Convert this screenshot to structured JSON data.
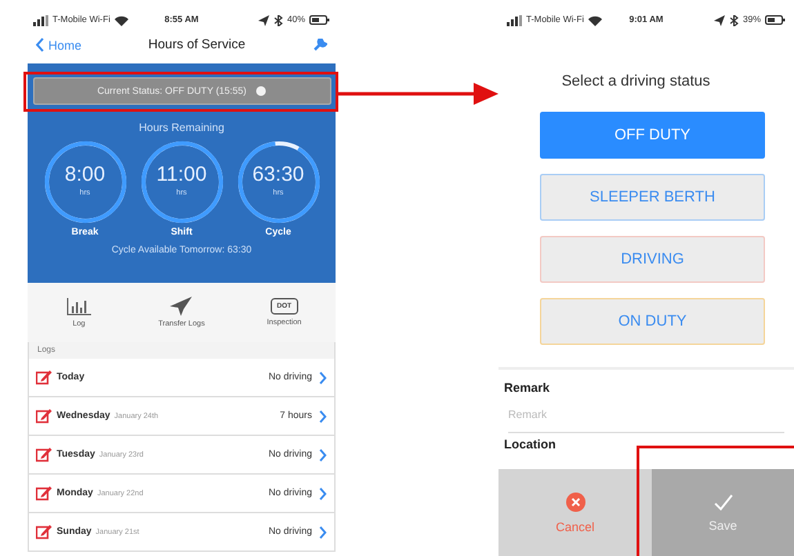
{
  "left_screen": {
    "status_bar": {
      "carrier": "T-Mobile Wi-Fi",
      "time": "8:55 AM",
      "battery": "40%"
    },
    "nav": {
      "back": "Home",
      "title": "Hours of Service"
    },
    "current_status": "Current Status: OFF DUTY (15:55)",
    "hours_title": "Hours Remaining",
    "gauges": [
      {
        "value": "8:00",
        "unit": "hrs",
        "label": "Break",
        "level": 1
      },
      {
        "value": "11:00",
        "unit": "hrs",
        "label": "Shift",
        "level": 1
      },
      {
        "value": "63:30",
        "unit": "hrs",
        "label": "Cycle",
        "level": 0.9
      }
    ],
    "cycle_note": "Cycle Available Tomorrow: 63:30",
    "toolbar": [
      {
        "kind": "chart",
        "label": "Log"
      },
      {
        "kind": "plane",
        "label": "Transfer Logs"
      },
      {
        "kind": "badge",
        "badge": "DOT",
        "label": "Inspection"
      }
    ],
    "logs_header": "Logs",
    "logs": [
      {
        "day": "Today",
        "value": "No driving"
      },
      {
        "day": "Wednesday",
        "date": "January 24th",
        "value": "7 hours"
      },
      {
        "day": "Tuesday",
        "date": "January 23rd",
        "value": "No driving"
      },
      {
        "day": "Monday",
        "date": "January 22nd",
        "value": "No driving"
      },
      {
        "day": "Sunday",
        "date": "January 21st",
        "value": "No driving"
      }
    ]
  },
  "right_screen": {
    "status_bar": {
      "carrier": "T-Mobile Wi-Fi",
      "time": "9:01 AM",
      "battery": "39%"
    },
    "prompt": "Select a driving status",
    "statuses": [
      {
        "label": "OFF DUTY",
        "selected": true,
        "color": "#2a8cff"
      },
      {
        "label": "SLEEPER BERTH",
        "selected": false,
        "color": "#a9cdf5"
      },
      {
        "label": "DRIVING",
        "selected": false,
        "color": "#f3c9c4"
      },
      {
        "label": "ON DUTY",
        "selected": false,
        "color": "#f5d59a"
      }
    ],
    "remark": {
      "label": "Remark",
      "placeholder": "Remark"
    },
    "location_label": "Location",
    "actions": [
      {
        "kind": "cancel",
        "label": "Cancel"
      },
      {
        "kind": "save",
        "label": "Save"
      }
    ]
  }
}
